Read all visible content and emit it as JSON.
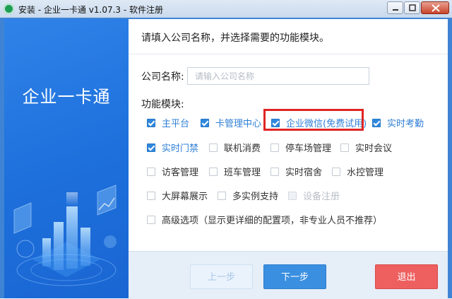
{
  "window": {
    "title": "安装 - 企业一卡通 v1.07.3 - 软件注册"
  },
  "left_panel": {
    "brand": "企业一卡通"
  },
  "main": {
    "instruction": "请填入公司名称，并选择需要的功能模块。",
    "company": {
      "label": "公司名称:",
      "value": "",
      "placeholder": "请输入公司名称"
    },
    "modules_label": "功能模块:",
    "modules": [
      {
        "label": "主平台",
        "state": "checked"
      },
      {
        "label": "卡管理中心",
        "state": "checked"
      },
      {
        "label": "企业微信(免费试用)",
        "state": "checked"
      },
      {
        "label": "实时考勤",
        "state": "checked"
      },
      {
        "label": "实时门禁",
        "state": "checked"
      },
      {
        "label": "联机消费",
        "state": "unchecked"
      },
      {
        "label": "停车场管理",
        "state": "unchecked"
      },
      {
        "label": "实时会议",
        "state": "unchecked"
      },
      {
        "label": "访客管理",
        "state": "unchecked"
      },
      {
        "label": "班车管理",
        "state": "unchecked"
      },
      {
        "label": "实时宿舍",
        "state": "unchecked"
      },
      {
        "label": "水控管理",
        "state": "unchecked"
      },
      {
        "label": "大屏幕展示",
        "state": "unchecked"
      },
      {
        "label": "多实例支持",
        "state": "unchecked"
      },
      {
        "label": "设备注册",
        "state": "disabled"
      }
    ],
    "advanced": {
      "label": "高级选项（显示更详细的配置项，非专业人员不推荐）",
      "state": "unchecked"
    }
  },
  "footer": {
    "prev_label": "上一步",
    "next_label": "下一步",
    "exit_label": "退出"
  },
  "colors": {
    "accent": "#2f88de",
    "highlight_border": "#e02424",
    "exit": "#ee5f5f"
  }
}
